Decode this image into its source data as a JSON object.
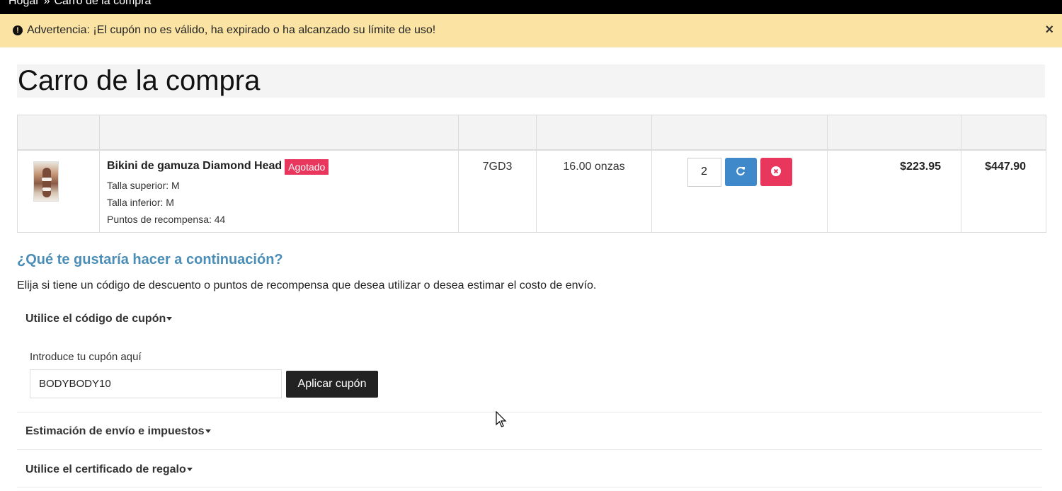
{
  "breadcrumb": {
    "home": "Hogar",
    "separator": "»",
    "current": "Carro de la compra"
  },
  "alert": {
    "icon": "exclamation-circle-icon",
    "message": "Advertencia: ¡El cupón no es válido, ha expirado o ha alcanzado su límite de uso!",
    "close": "×"
  },
  "page_title": "Carro de la compra",
  "cart": {
    "headers": [
      "",
      "",
      "",
      "",
      "",
      "",
      ""
    ],
    "items": [
      {
        "image_icon": "product-thumbnail",
        "name": "Bikini de gamuza Diamond Head",
        "badge": "Agotado",
        "options": [
          "Talla superior: M",
          "Talla inferior: M",
          "Puntos de recompensa: 44"
        ],
        "model": "7GD3",
        "weight": "16.00 onzas",
        "quantity": "2",
        "unit_price": "$223.95",
        "total": "$447.90"
      }
    ]
  },
  "next": {
    "title": "¿Qué te gustaría hacer a continuación?",
    "description": "Elija si tiene un código de descuento o puntos de recompensa que desea utilizar o desea estimar el costo de envío."
  },
  "accordion": {
    "coupon": {
      "heading": "Utilice el código de cupón",
      "label": "Introduce tu cupón aquí",
      "value": "BODYBODY10",
      "button": "Aplicar cupón"
    },
    "shipping": {
      "heading": "Estimación de envío e impuestos"
    },
    "voucher": {
      "heading": "Utilice el certificado de regalo"
    }
  },
  "colors": {
    "alert_bg": "#fbe3a4",
    "badge": "#e8365d",
    "update_button": "#3f88c9",
    "remove_button": "#e8365d",
    "heading_accent": "#4a8db7"
  }
}
